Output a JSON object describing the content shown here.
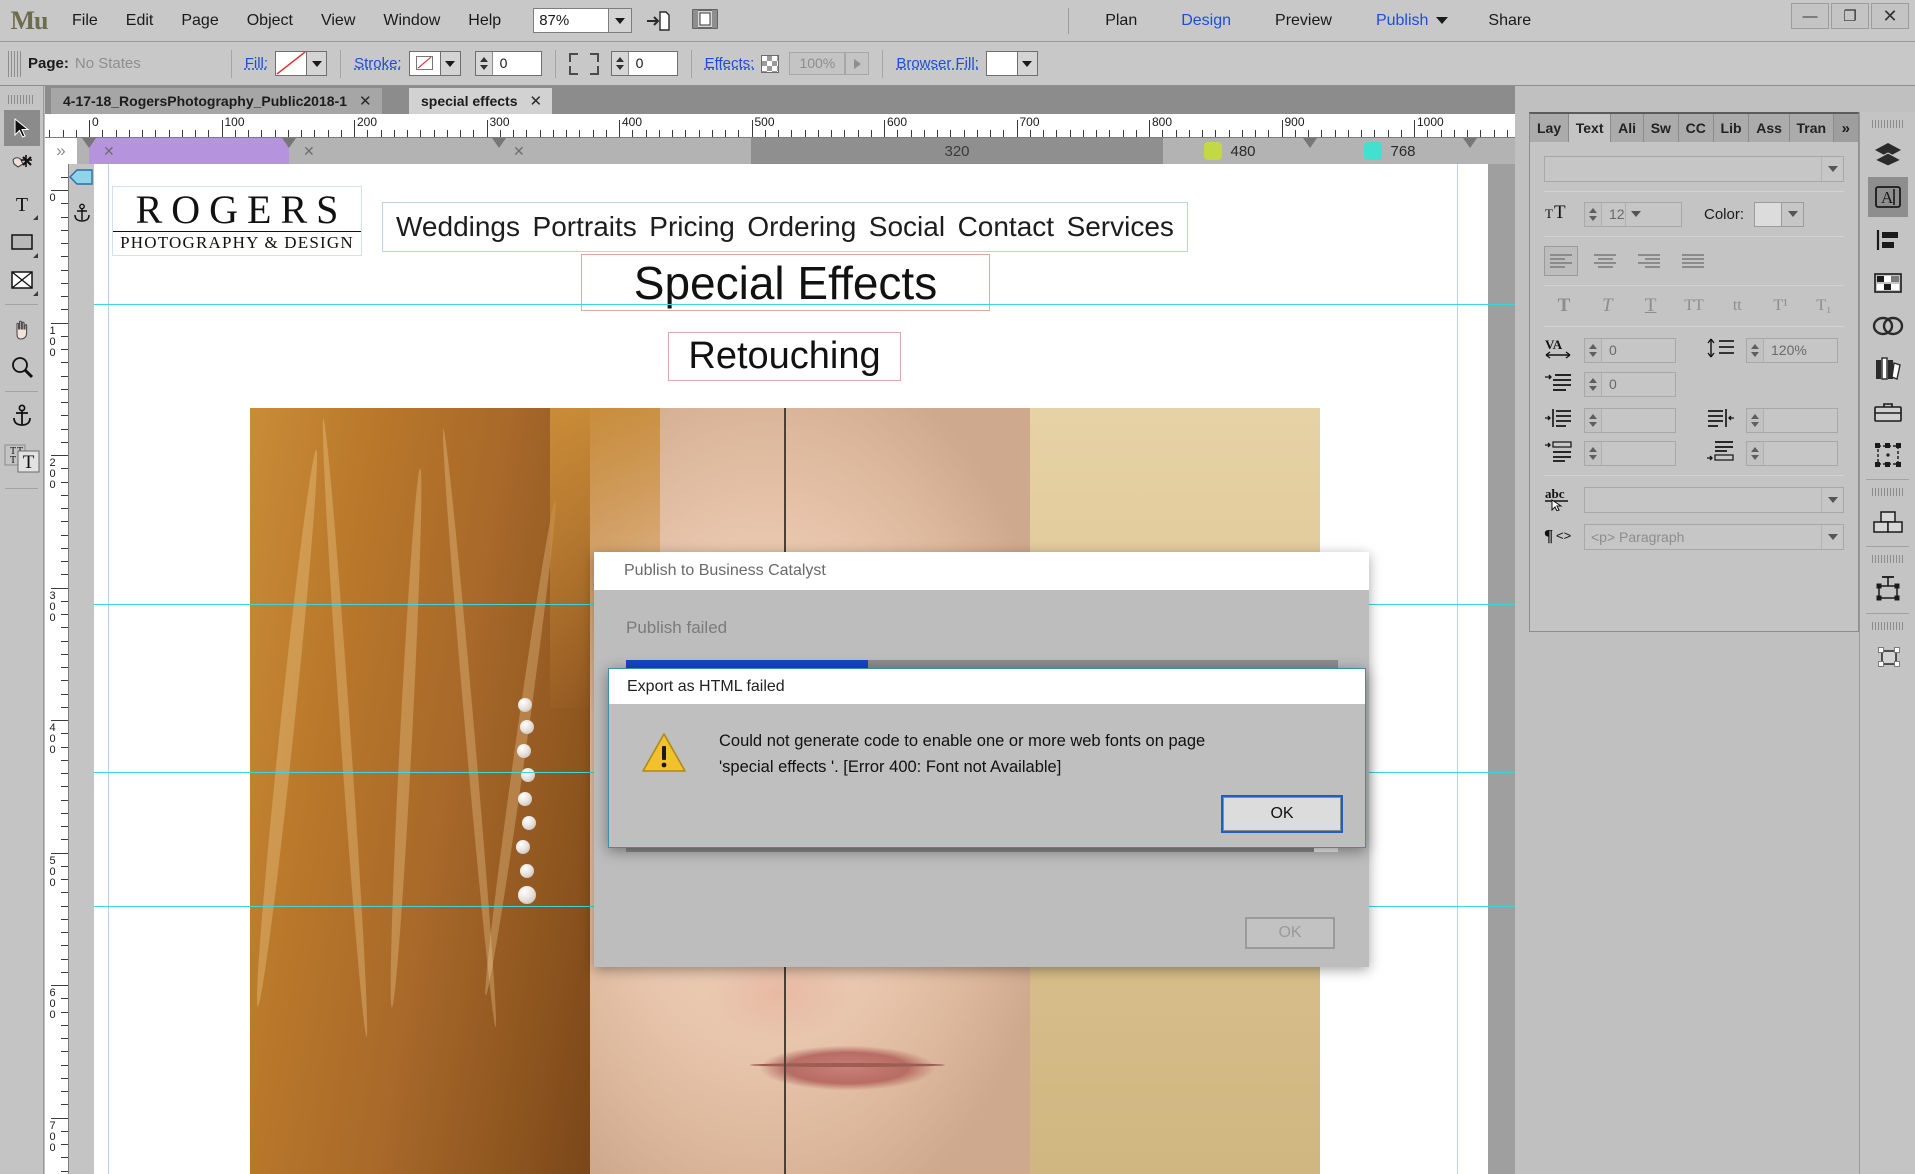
{
  "app": {
    "name": "Mu",
    "zoom": "87%"
  },
  "menu": {
    "items": [
      "File",
      "Edit",
      "Page",
      "Object",
      "View",
      "Window",
      "Help"
    ]
  },
  "workspace": {
    "modes": [
      {
        "label": "Plan",
        "active": false
      },
      {
        "label": "Design",
        "active": true
      },
      {
        "label": "Preview",
        "active": false
      },
      {
        "label": "Publish",
        "active": false,
        "caret": true
      },
      {
        "label": "Share",
        "active": false
      }
    ]
  },
  "window_controls": {
    "minimize": "—",
    "maximize": "❐",
    "close": "✕"
  },
  "control_bar": {
    "page_label": "Page:",
    "page_value": "No States",
    "fill_label": "Fill:",
    "stroke_label": "Stroke:",
    "stroke_width": "0",
    "corner_radius": "0",
    "effects_label": "Effects:",
    "effects_opacity": "100%",
    "browser_fill_label": "Browser Fill:"
  },
  "toolbox": {
    "tools": [
      {
        "name": "selection-tool",
        "glyph": "➤",
        "selected": true
      },
      {
        "name": "crop-tool",
        "glyph": "✂",
        "selected": false
      },
      {
        "name": "text-tool",
        "glyph": "T",
        "selected": false
      },
      {
        "name": "rectangle-tool",
        "glyph": "▭",
        "selected": false
      },
      {
        "name": "image-placeholder-tool",
        "glyph": "✉",
        "selected": false
      },
      {
        "name": "hand-tool",
        "glyph": "✋",
        "selected": false
      },
      {
        "name": "zoom-tool",
        "glyph": "⚲",
        "selected": false
      },
      {
        "name": "anchor-tool",
        "glyph": "⚓",
        "selected": false
      },
      {
        "name": "text-frame-tool",
        "glyph": "T",
        "selected": false
      }
    ]
  },
  "tabs": [
    {
      "label": "4-17-18_RogersPhotography_Public2018-1",
      "active": false,
      "close": "✕"
    },
    {
      "label": "special effects",
      "active": true,
      "close": "✕"
    }
  ],
  "rulers": {
    "horizontal_labels": [
      "0",
      "100",
      "200",
      "300",
      "400",
      "500",
      "600",
      "700",
      "800",
      "900",
      "1000"
    ],
    "vertical_labels": [
      "0",
      "100",
      "200",
      "300",
      "400",
      "500",
      "600",
      "700"
    ]
  },
  "breakpoints": {
    "markers": [
      {
        "label": "320",
        "active": false
      },
      {
        "label": "480",
        "active": false,
        "color": "#c3d845"
      },
      {
        "label": "768",
        "active": false,
        "color": "#42e0d0"
      }
    ],
    "close_glyphs": [
      "✕",
      "✕",
      "✕",
      "✕"
    ],
    "collapse_glyph": "»"
  },
  "canvas": {
    "logo": {
      "line1": "ROGERS",
      "line2": "PHOTOGRAPHY & DESIGN"
    },
    "nav": [
      "Weddings",
      "Portraits",
      "Pricing",
      "Ordering",
      "Social",
      "Contact",
      "Services"
    ],
    "heading": "Special Effects",
    "subheading": "Retouching"
  },
  "text_panel": {
    "tabs": [
      {
        "label": "Lay",
        "active": false
      },
      {
        "label": "Text",
        "active": true
      },
      {
        "label": "Ali",
        "active": false
      },
      {
        "label": "Sw",
        "active": false
      },
      {
        "label": "CC",
        "active": false
      },
      {
        "label": "Lib",
        "active": false
      },
      {
        "label": "Ass",
        "active": false
      },
      {
        "label": "Tran",
        "active": false
      }
    ],
    "more_glyph": "»",
    "font_family_value": "",
    "font_size": "12",
    "color_label": "Color:",
    "tracking": "0",
    "leading": "120%",
    "indent": "0",
    "left_indent": "",
    "right_indent": "",
    "space_before": "",
    "space_after": "",
    "character_style_value": "",
    "paragraph_style_value": "<p> Paragraph",
    "style_glyphs": [
      "T",
      "T",
      "T",
      "TT",
      "tt",
      "T¹",
      "T₁"
    ]
  },
  "dock_icons": [
    {
      "name": "layers-icon",
      "selected": false
    },
    {
      "name": "text-panel-icon",
      "selected": true
    },
    {
      "name": "align-icon",
      "selected": false
    },
    {
      "name": "swatches-icon",
      "selected": false
    },
    {
      "name": "cc-libraries-icon",
      "selected": false
    },
    {
      "name": "library-icon",
      "selected": false
    },
    {
      "name": "business-catalyst-icon",
      "selected": false
    },
    {
      "name": "assets-icon",
      "selected": false
    },
    {
      "name": "widgets-icon",
      "selected": false
    },
    {
      "name": "states-icon",
      "selected": false
    },
    {
      "name": "transform-icon",
      "selected": false
    }
  ],
  "publish_dialog": {
    "title": "Publish to Business Catalyst",
    "status": "Publish failed",
    "progress_percent": 34,
    "ok_label": "OK",
    "scroll_glyph": "ˇ"
  },
  "error_dialog": {
    "title": "Export as HTML failed",
    "message_line1": "Could not generate code to enable one or more web fonts on page",
    "message_line2": "'special effects '. [Error 400: Font not Available]",
    "ok_label": "OK",
    "icon": "warning-triangle-icon"
  },
  "colors": {
    "chrome": "#c4c4c4",
    "accent_blue": "#1b4fd8",
    "progress_blue": "#1446c8",
    "warning_yellow": "#f2c12e",
    "guide_cyan": "#3dd6e0",
    "breakpoint_purple": "#b693dd"
  }
}
